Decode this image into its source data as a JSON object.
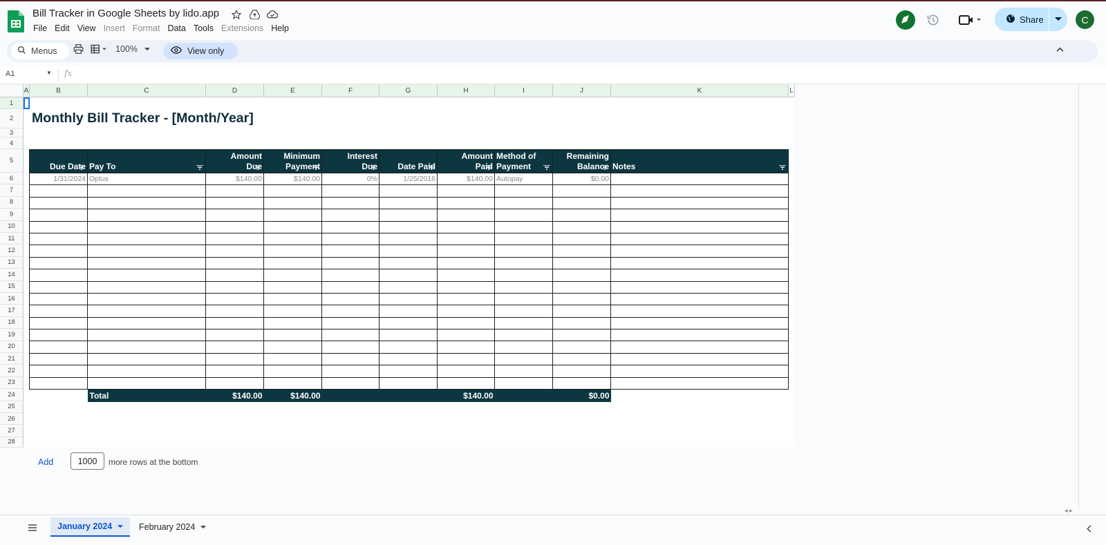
{
  "app": {
    "doc_title": "Bill Tracker in Google Sheets by lido.app",
    "menu": [
      "File",
      "Edit",
      "View",
      "Insert",
      "Format",
      "Data",
      "Tools",
      "Extensions",
      "Help"
    ],
    "share_label": "Share",
    "avatar_letter": "C"
  },
  "toolbar": {
    "menus_label": "Menus",
    "zoom": "100%",
    "view_only_label": "View only"
  },
  "formula_bar": {
    "cell_ref": "A1",
    "fx": "fx"
  },
  "grid": {
    "columns": [
      "A",
      "B",
      "C",
      "D",
      "E",
      "F",
      "G",
      "H",
      "I",
      "J",
      "K",
      "L"
    ],
    "rows": [
      "1",
      "2",
      "3",
      "4",
      "5",
      "6",
      "7",
      "8",
      "9",
      "10",
      "11",
      "12",
      "13",
      "14",
      "15",
      "16",
      "17",
      "18",
      "19",
      "20",
      "21",
      "22",
      "23",
      "24",
      "25",
      "26",
      "27",
      "28"
    ]
  },
  "sheet": {
    "title": "Monthly Bill Tracker - [Month/Year]",
    "headers": [
      {
        "line1": "",
        "line2": "Due Date"
      },
      {
        "line1": "",
        "line2": "Pay To"
      },
      {
        "line1": "Amount",
        "line2": "Due"
      },
      {
        "line1": "Minimum",
        "line2": "Payment"
      },
      {
        "line1": "Interest",
        "line2": "Due"
      },
      {
        "line1": "",
        "line2": "Date Paid"
      },
      {
        "line1": "Amount",
        "line2": "Paid"
      },
      {
        "line1": "Method of",
        "line2": "Payment"
      },
      {
        "line1": "Remaining",
        "line2": "Balance"
      },
      {
        "line1": "",
        "line2": "Notes"
      }
    ],
    "first_row": [
      "1/31/2024",
      "Optus",
      "$140.00",
      "$140.00",
      "0%",
      "1/25/2016",
      "$140.00",
      "Autopay",
      "$0.00",
      ""
    ],
    "total": {
      "label": "Total",
      "amount_due": "$140.00",
      "minimum_payment": "$140.00",
      "amount_paid": "$140.00",
      "remaining_balance": "$0.00"
    }
  },
  "add_rows": {
    "link": "Add",
    "count": "1000",
    "suffix": "more rows at the bottom"
  },
  "tabs": [
    "January 2024",
    "February 2024"
  ]
}
